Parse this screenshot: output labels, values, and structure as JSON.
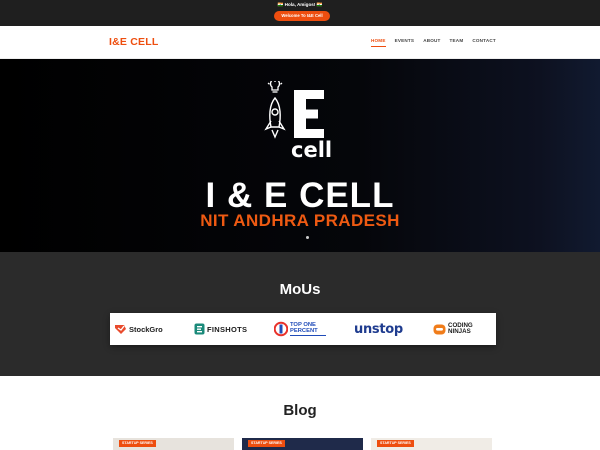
{
  "topbar": {
    "greeting": "🇮🇳 Hola, Amigos! 🇮🇳",
    "welcome_label": "Welcome To I&E Cell"
  },
  "navbar": {
    "brand": "I&E CELL",
    "items": [
      {
        "label": "HOME",
        "active": true
      },
      {
        "label": "EVENTS",
        "active": false
      },
      {
        "label": "ABOUT",
        "active": false
      },
      {
        "label": "TEAM",
        "active": false
      },
      {
        "label": "CONTACT",
        "active": false
      }
    ]
  },
  "hero": {
    "logo_text": "cell",
    "logo_letter": "E",
    "title": "I & E CELL",
    "subtitle": "NIT ANDHRA PRADESH"
  },
  "mous": {
    "heading": "MoUs",
    "partners": [
      {
        "name": "StockGro",
        "icon": "stockgro-logo-icon",
        "color": "#e94b2d"
      },
      {
        "name": "FINSHOTS",
        "icon": "finshots-logo-icon",
        "color": "#1a1a1a"
      },
      {
        "name_line1": "TOP ONE",
        "name_line2": "PERCENT",
        "icon": "top-one-percent-logo-icon",
        "color": "#1f4bb8"
      },
      {
        "name": "unstop",
        "icon": "unstop-logo-icon",
        "color": "#1f3c8f"
      },
      {
        "name_line1": "CODING",
        "name_line2": "NINJAS",
        "icon": "coding-ninjas-logo-icon",
        "color": "#f07c1a"
      }
    ]
  },
  "blog": {
    "heading": "Blog",
    "cards": [
      {
        "tag": "STARTUP SERIES"
      },
      {
        "tag": "STARTUP SERIES"
      },
      {
        "tag": "STARTUP SERIES"
      }
    ]
  },
  "colors": {
    "accent": "#ee4e0f",
    "topbar_bg": "#1f1f1f",
    "mous_bg": "#2b2b2b"
  }
}
